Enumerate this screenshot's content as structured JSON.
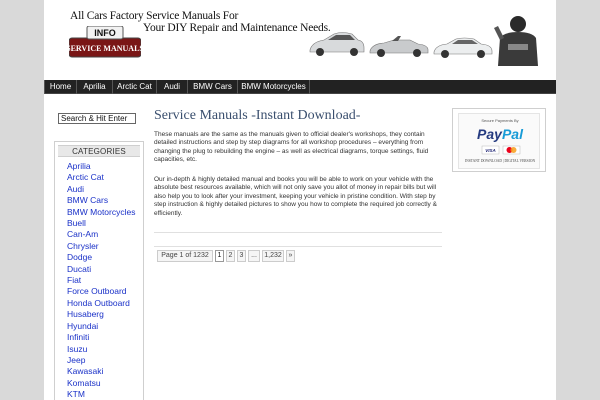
{
  "header": {
    "logo_line1": "All Cars Factory Service Manuals For",
    "logo_line2": "Your DIY Repair and Maintenance Needs.",
    "badge_top": "INFO",
    "badge_bottom": "SERVICE MANUALS"
  },
  "nav": {
    "items": [
      "Home",
      "Aprilia",
      "Arctic Cat",
      "Audi",
      "BMW Cars",
      "BMW Motorcycles"
    ]
  },
  "sidebar": {
    "search_placeholder": "Search & Hit Enter",
    "categories_heading": "CATEGORIES",
    "categories": [
      "Aprilia",
      "Arctic Cat",
      "Audi",
      "BMW Cars",
      "BMW Motorcycles",
      "Buell",
      "Can-Am",
      "Chrysler",
      "Dodge",
      "Ducati",
      "Fiat",
      "Force Outboard",
      "Honda Outboard",
      "Husaberg",
      "Hyundai",
      "Infiniti",
      "Isuzu",
      "Jeep",
      "Kawasaki",
      "Komatsu",
      "KTM"
    ]
  },
  "main": {
    "title": "Service Manuals -Instant Download-",
    "paragraph1": "These manuals are the same as the manuals given to official dealer's workshops, they contain detailed instructions and step by step diagrams for all workshop procedures – everything from changing the plug to rebuilding the engine – as well as electrical diagrams, torque settings, fluid capacities, etc.",
    "paragraph2": "Our in-depth & highly detailed manual and books you will be able to work on your vehicle with the absolute best resources available, which will not only save you allot of money in repair bills but will also help you to look after your investment, keeping your vehicle in pristine condition. With step by step instruction & highly detailed pictures to show you how to complete the required job correctly & efficiently.",
    "pagination": {
      "page_info": "Page 1 of 1232",
      "pages": [
        "1",
        "2",
        "3",
        "...",
        "1,232",
        "»"
      ]
    }
  },
  "paypal": {
    "secure_text": "Secure Payments By",
    "logo_pay": "Pay",
    "logo_pal": "Pal",
    "cards": [
      "VISA",
      "MasterCard"
    ],
    "footer": "INSTANT DOWNLOAD | DIGITAL VERSION"
  },
  "colors": {
    "nav_bg": "#222222",
    "link": "#1a31c8",
    "title": "#3a4f6e",
    "page_bg": "#d9d9d9"
  }
}
